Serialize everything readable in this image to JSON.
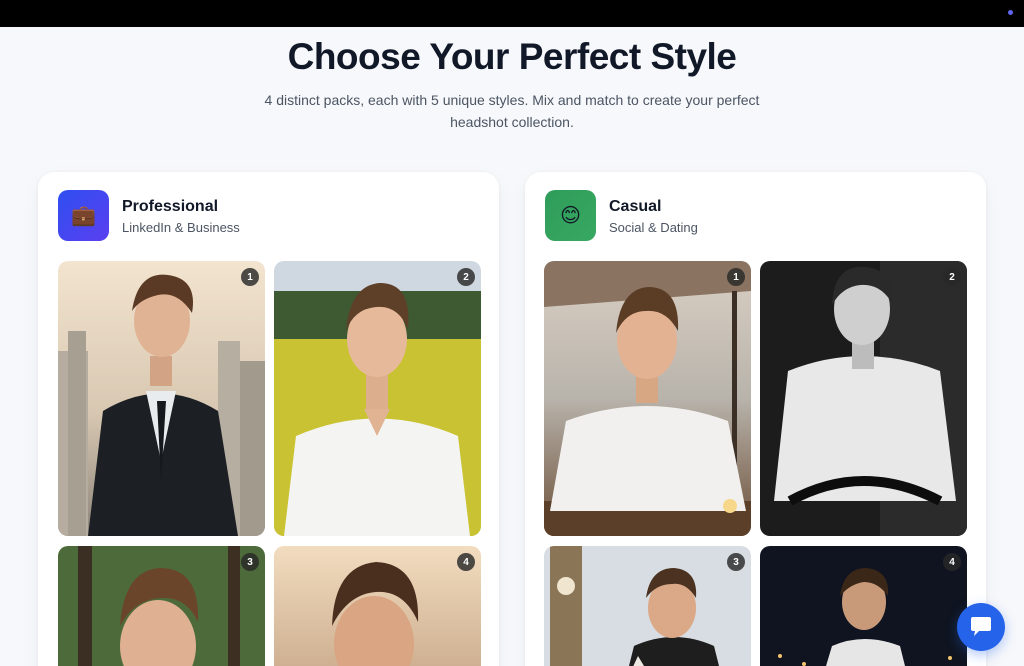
{
  "hero": {
    "title": "Choose Your Perfect Style",
    "subtitle": "4 distinct packs, each with 5 unique styles. Mix and match to create your perfect headshot collection."
  },
  "packs": [
    {
      "name": "Professional",
      "description": "LinkedIn & Business",
      "icon": "briefcase-icon",
      "icon_glyph": "💼",
      "accent": "#3b4ef0",
      "styles": [
        {
          "number": "1",
          "scene": "city-suit"
        },
        {
          "number": "2",
          "scene": "field-white-shirt"
        },
        {
          "number": "3",
          "scene": "forest"
        },
        {
          "number": "4",
          "scene": "sunset"
        }
      ]
    },
    {
      "name": "Casual",
      "description": "Social & Dating",
      "icon": "smiley-icon",
      "icon_glyph": "😊",
      "accent": "#34a35f",
      "styles": [
        {
          "number": "1",
          "scene": "cafe-terrace"
        },
        {
          "number": "2",
          "scene": "black-and-white-chair"
        },
        {
          "number": "3",
          "scene": "big-ben"
        },
        {
          "number": "4",
          "scene": "night-city"
        }
      ]
    }
  ],
  "chat": {
    "icon": "chat-icon",
    "color": "#2563eb"
  }
}
